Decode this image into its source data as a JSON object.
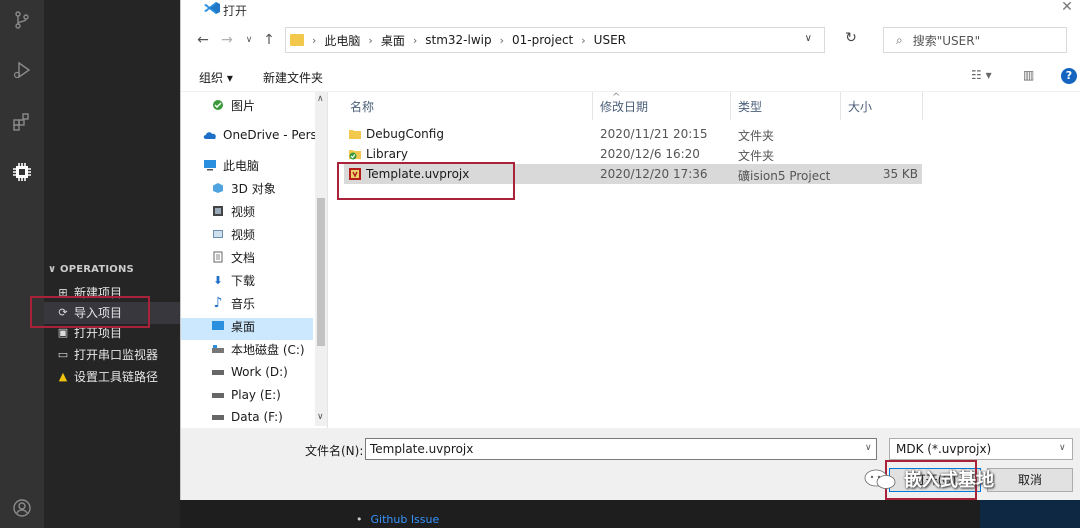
{
  "vscode": {
    "activity_icons": [
      "source-control-icon",
      "run-debug-icon",
      "extensions-icon",
      "chip-icon",
      "account-icon"
    ],
    "operations": {
      "header": "OPERATIONS",
      "items": [
        {
          "label": "新建项目",
          "icon": "new-project-icon"
        },
        {
          "label": "导入项目",
          "icon": "import-project-icon"
        },
        {
          "label": "打开项目",
          "icon": "open-project-icon"
        },
        {
          "label": "打开串口监视器",
          "icon": "serial-monitor-icon"
        },
        {
          "label": "设置工具链路径",
          "icon": "warning-icon"
        }
      ]
    },
    "github_issue": "Github Issue"
  },
  "dialog": {
    "title": "打开",
    "address": {
      "crumbs": [
        "此电脑",
        "桌面",
        "stm32-lwip",
        "01-project",
        "USER"
      ]
    },
    "search_placeholder": "搜索\"USER\"",
    "toolbar": {
      "organize": "组织 ▾",
      "new_folder": "新建文件夹"
    },
    "nav_items": [
      {
        "label": "图片",
        "icon": "pictures-icon",
        "level": "sub"
      },
      {
        "label": "OneDrive - Perso",
        "icon": "onedrive-icon",
        "level": "top"
      },
      {
        "label": "此电脑",
        "icon": "this-pc-icon",
        "level": "top"
      },
      {
        "label": "3D 对象",
        "icon": "3d-objects-icon",
        "level": "sub"
      },
      {
        "label": "视频",
        "icon": "videos-icon",
        "level": "sub"
      },
      {
        "label": "视频",
        "icon": "videos-icon",
        "level": "sub"
      },
      {
        "label": "文档",
        "icon": "documents-icon",
        "level": "sub"
      },
      {
        "label": "下载",
        "icon": "downloads-icon",
        "level": "sub"
      },
      {
        "label": "音乐",
        "icon": "music-icon",
        "level": "sub"
      },
      {
        "label": "桌面",
        "icon": "desktop-icon",
        "level": "sub"
      },
      {
        "label": "本地磁盘 (C:)",
        "icon": "drive-c-icon",
        "level": "sub"
      },
      {
        "label": "Work (D:)",
        "icon": "drive-icon",
        "level": "sub"
      },
      {
        "label": "Play (E:)",
        "icon": "drive-icon",
        "level": "sub"
      },
      {
        "label": "Data (F:)",
        "icon": "drive-icon",
        "level": "sub"
      }
    ],
    "columns": [
      "名称",
      "修改日期",
      "类型",
      "大小"
    ],
    "files": [
      {
        "name": "DebugConfig",
        "date": "2020/11/21 20:15",
        "type": "文件夹",
        "size": "",
        "icon": "folder-icon"
      },
      {
        "name": "Library",
        "date": "2020/12/6 16:20",
        "type": "文件夹",
        "size": "",
        "icon": "folder-synced-icon"
      },
      {
        "name": "Template.uvprojx",
        "date": "2020/12/20 17:36",
        "type": "礦ision5 Project",
        "size": "35 KB",
        "icon": "uvision-icon"
      }
    ],
    "filename_label": "文件名(N):",
    "filename_value": "Template.uvprojx",
    "filetype_value": "MDK (*.uvprojx)",
    "open_label": "打开(O)",
    "cancel_label": "取消"
  },
  "watermark": "嵌入式基地",
  "colors": {
    "highlight_box": "#a8233a",
    "selection": "#cce8ff",
    "accent": "#0078d7"
  }
}
